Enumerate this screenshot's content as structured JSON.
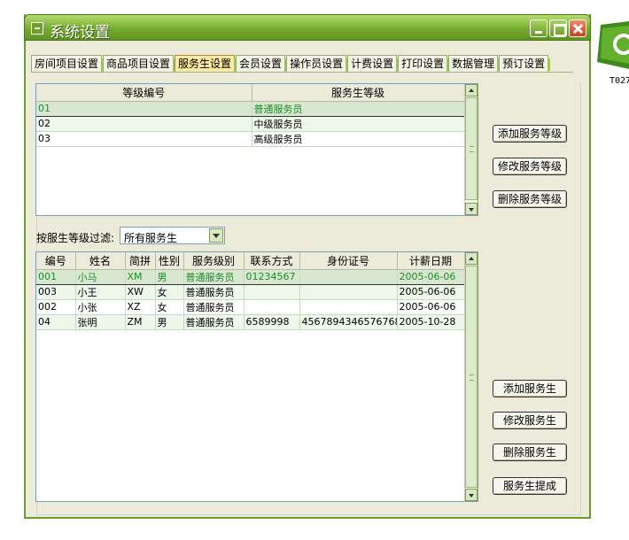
{
  "window": {
    "title": "系统设置"
  },
  "tabs": [
    {
      "label": "房间项目设置",
      "active": false
    },
    {
      "label": "商品项目设置",
      "active": false
    },
    {
      "label": "服务生设置",
      "active": true
    },
    {
      "label": "会员设置",
      "active": false
    },
    {
      "label": "操作员设置",
      "active": false
    },
    {
      "label": "计费设置",
      "active": false
    },
    {
      "label": "打印设置",
      "active": false
    },
    {
      "label": "数据管理",
      "active": false
    },
    {
      "label": "预订设置",
      "active": false
    }
  ],
  "level_grid": {
    "columns": [
      "等级编号",
      "服务生等级"
    ],
    "rows": [
      [
        "01",
        "普通服务员"
      ],
      [
        "02",
        "中级服务员"
      ],
      [
        "03",
        "高级服务员"
      ]
    ],
    "selected_row": 0
  },
  "level_buttons": {
    "add": "添加服务等级",
    "edit": "修改服务等级",
    "delete": "删除服务等级"
  },
  "filter": {
    "label": "按服生等级过滤:",
    "selected": "所有服务生"
  },
  "staff_grid": {
    "columns": [
      "编号",
      "姓名",
      "简拼",
      "性别",
      "服务级别",
      "联系方式",
      "身份证号",
      "计薪日期"
    ],
    "rows": [
      [
        "001",
        "小马",
        "XM",
        "男",
        "普通服务员",
        "01234567",
        "",
        "2005-06-06"
      ],
      [
        "003",
        "小王",
        "XW",
        "女",
        "普通服务员",
        "",
        "",
        "2005-06-06"
      ],
      [
        "002",
        "小张",
        "XZ",
        "女",
        "普通服务员",
        "",
        "",
        "2005-06-06"
      ],
      [
        "04",
        "张明",
        "ZM",
        "男",
        "普通服务员",
        "6589998",
        "4567894346576768",
        "2005-10-28"
      ]
    ],
    "selected_row": 0
  },
  "staff_buttons": {
    "add": "添加服务生",
    "edit": "修改服务生",
    "delete": "删除服务生",
    "commission": "服务生提成"
  },
  "side_label": "T027"
}
